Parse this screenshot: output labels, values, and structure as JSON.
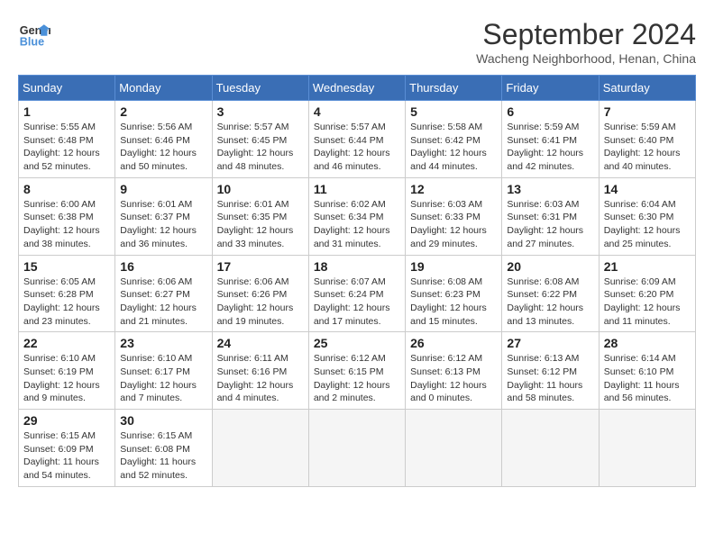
{
  "header": {
    "logo_line1": "General",
    "logo_line2": "Blue",
    "month_year": "September 2024",
    "location": "Wacheng Neighborhood, Henan, China"
  },
  "weekdays": [
    "Sunday",
    "Monday",
    "Tuesday",
    "Wednesday",
    "Thursday",
    "Friday",
    "Saturday"
  ],
  "weeks": [
    [
      {
        "day": "1",
        "sunrise": "5:55 AM",
        "sunset": "6:48 PM",
        "daylight": "12 hours and 52 minutes."
      },
      {
        "day": "2",
        "sunrise": "5:56 AM",
        "sunset": "6:46 PM",
        "daylight": "12 hours and 50 minutes."
      },
      {
        "day": "3",
        "sunrise": "5:57 AM",
        "sunset": "6:45 PM",
        "daylight": "12 hours and 48 minutes."
      },
      {
        "day": "4",
        "sunrise": "5:57 AM",
        "sunset": "6:44 PM",
        "daylight": "12 hours and 46 minutes."
      },
      {
        "day": "5",
        "sunrise": "5:58 AM",
        "sunset": "6:42 PM",
        "daylight": "12 hours and 44 minutes."
      },
      {
        "day": "6",
        "sunrise": "5:59 AM",
        "sunset": "6:41 PM",
        "daylight": "12 hours and 42 minutes."
      },
      {
        "day": "7",
        "sunrise": "5:59 AM",
        "sunset": "6:40 PM",
        "daylight": "12 hours and 40 minutes."
      }
    ],
    [
      {
        "day": "8",
        "sunrise": "6:00 AM",
        "sunset": "6:38 PM",
        "daylight": "12 hours and 38 minutes."
      },
      {
        "day": "9",
        "sunrise": "6:01 AM",
        "sunset": "6:37 PM",
        "daylight": "12 hours and 36 minutes."
      },
      {
        "day": "10",
        "sunrise": "6:01 AM",
        "sunset": "6:35 PM",
        "daylight": "12 hours and 33 minutes."
      },
      {
        "day": "11",
        "sunrise": "6:02 AM",
        "sunset": "6:34 PM",
        "daylight": "12 hours and 31 minutes."
      },
      {
        "day": "12",
        "sunrise": "6:03 AM",
        "sunset": "6:33 PM",
        "daylight": "12 hours and 29 minutes."
      },
      {
        "day": "13",
        "sunrise": "6:03 AM",
        "sunset": "6:31 PM",
        "daylight": "12 hours and 27 minutes."
      },
      {
        "day": "14",
        "sunrise": "6:04 AM",
        "sunset": "6:30 PM",
        "daylight": "12 hours and 25 minutes."
      }
    ],
    [
      {
        "day": "15",
        "sunrise": "6:05 AM",
        "sunset": "6:28 PM",
        "daylight": "12 hours and 23 minutes."
      },
      {
        "day": "16",
        "sunrise": "6:06 AM",
        "sunset": "6:27 PM",
        "daylight": "12 hours and 21 minutes."
      },
      {
        "day": "17",
        "sunrise": "6:06 AM",
        "sunset": "6:26 PM",
        "daylight": "12 hours and 19 minutes."
      },
      {
        "day": "18",
        "sunrise": "6:07 AM",
        "sunset": "6:24 PM",
        "daylight": "12 hours and 17 minutes."
      },
      {
        "day": "19",
        "sunrise": "6:08 AM",
        "sunset": "6:23 PM",
        "daylight": "12 hours and 15 minutes."
      },
      {
        "day": "20",
        "sunrise": "6:08 AM",
        "sunset": "6:22 PM",
        "daylight": "12 hours and 13 minutes."
      },
      {
        "day": "21",
        "sunrise": "6:09 AM",
        "sunset": "6:20 PM",
        "daylight": "12 hours and 11 minutes."
      }
    ],
    [
      {
        "day": "22",
        "sunrise": "6:10 AM",
        "sunset": "6:19 PM",
        "daylight": "12 hours and 9 minutes."
      },
      {
        "day": "23",
        "sunrise": "6:10 AM",
        "sunset": "6:17 PM",
        "daylight": "12 hours and 7 minutes."
      },
      {
        "day": "24",
        "sunrise": "6:11 AM",
        "sunset": "6:16 PM",
        "daylight": "12 hours and 4 minutes."
      },
      {
        "day": "25",
        "sunrise": "6:12 AM",
        "sunset": "6:15 PM",
        "daylight": "12 hours and 2 minutes."
      },
      {
        "day": "26",
        "sunrise": "6:12 AM",
        "sunset": "6:13 PM",
        "daylight": "12 hours and 0 minutes."
      },
      {
        "day": "27",
        "sunrise": "6:13 AM",
        "sunset": "6:12 PM",
        "daylight": "11 hours and 58 minutes."
      },
      {
        "day": "28",
        "sunrise": "6:14 AM",
        "sunset": "6:10 PM",
        "daylight": "11 hours and 56 minutes."
      }
    ],
    [
      {
        "day": "29",
        "sunrise": "6:15 AM",
        "sunset": "6:09 PM",
        "daylight": "11 hours and 54 minutes."
      },
      {
        "day": "30",
        "sunrise": "6:15 AM",
        "sunset": "6:08 PM",
        "daylight": "11 hours and 52 minutes."
      },
      null,
      null,
      null,
      null,
      null
    ]
  ]
}
